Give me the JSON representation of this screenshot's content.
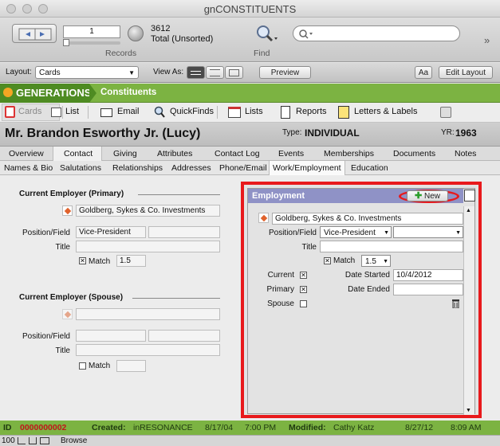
{
  "window": {
    "title": "gnCONSTITUENTS"
  },
  "toolbar": {
    "record_number": "1",
    "found_count": "3612",
    "total_label": "Total (Unsorted)",
    "records_label": "Records",
    "find_label": "Find",
    "search_placeholder": ""
  },
  "layoutbar": {
    "layout_label": "Layout:",
    "layout_value": "Cards",
    "view_as_label": "View As:",
    "preview_label": "Preview",
    "aa_label": "Aa",
    "edit_layout_label": "Edit Layout"
  },
  "brand": {
    "logo": "GENERATIONS",
    "module": "Constituents"
  },
  "nav": {
    "items": [
      "Cards",
      "List",
      "Email",
      "QuickFinds",
      "Lists",
      "Reports",
      "Letters & Labels"
    ]
  },
  "record": {
    "name": "Mr. Brandon Esworthy Jr. (Lucy)",
    "type_label": "Type:",
    "type_value": "INDIVIDUAL",
    "yr_label": "YR:",
    "yr_value": "1963"
  },
  "tabs1": [
    "Overview",
    "Contact",
    "Giving",
    "Attributes",
    "Contact Log",
    "Events",
    "Memberships",
    "Documents",
    "Notes"
  ],
  "tabs2": [
    "Names & Bio",
    "Salutations",
    "Relationships",
    "Addresses",
    "Phone/Email",
    "Work/Employment",
    "Education"
  ],
  "left": {
    "primary_title": "Current Employer (Primary)",
    "primary_employer": "Goldberg, Sykes & Co. Investments",
    "position_label": "Position/Field",
    "position_value": "Vice-President",
    "title_label": "Title",
    "match_label": "Match",
    "match_value": "1.5",
    "spouse_title": "Current Employer (Spouse)",
    "spouse_position_label": "Position/Field",
    "spouse_title_label": "Title",
    "spouse_match_label": "Match"
  },
  "panel": {
    "title": "Employment",
    "new_label": "New",
    "employer": "Goldberg, Sykes & Co. Investments",
    "position_label": "Position/Field",
    "position_value": "Vice-President",
    "title_label": "Title",
    "match_label": "Match",
    "match_value": "1.5",
    "current_label": "Current",
    "primary_label": "Primary",
    "spouse_label": "Spouse",
    "date_started_label": "Date Started",
    "date_started_value": "10/4/2012",
    "date_ended_label": "Date Ended",
    "accent_color": "#e8191c"
  },
  "status": {
    "id_label": "ID",
    "id_value": "0000000002",
    "created_label": "Created:",
    "created_by": "inRESONANCE",
    "created_date": "8/17/04",
    "created_time": "7:00 PM",
    "modified_label": "Modified:",
    "modified_by": "Cathy Katz",
    "modified_date": "8/27/12",
    "modified_time": "8:09 AM"
  },
  "bottom": {
    "zoom": "100",
    "mode": "Browse"
  }
}
